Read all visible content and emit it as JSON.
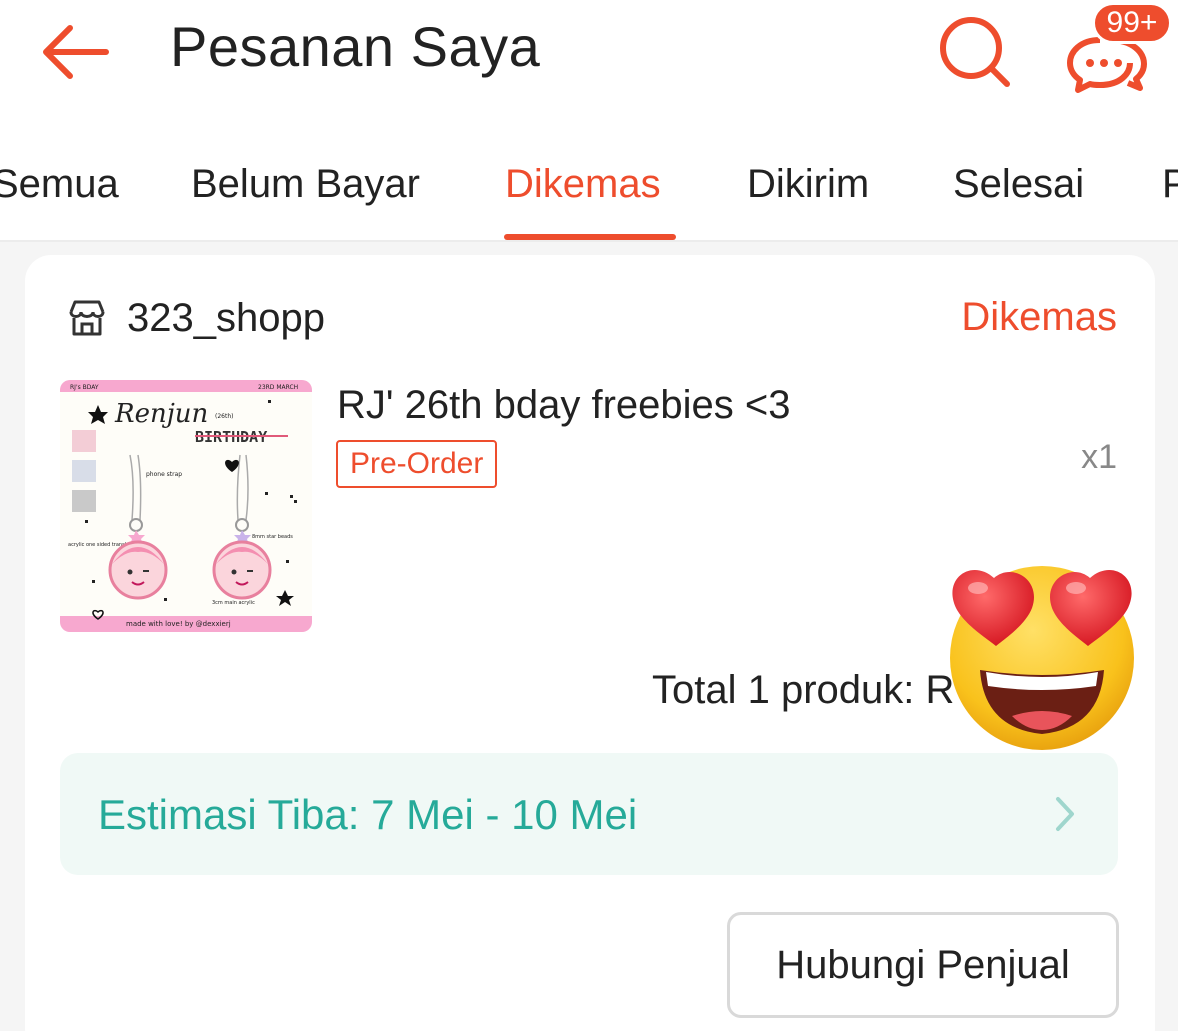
{
  "header": {
    "title": "Pesanan Saya",
    "back_icon": "arrow-left-icon",
    "search_icon": "search-icon",
    "chat_icon": "chat-bubbles-icon",
    "chat_badge": "99+"
  },
  "tabs": [
    {
      "label": "Semua",
      "active": false
    },
    {
      "label": "Belum Bayar",
      "active": false
    },
    {
      "label": "Dikemas",
      "active": true
    },
    {
      "label": "Dikirim",
      "active": false
    },
    {
      "label": "Selesai",
      "active": false
    },
    {
      "label": "P",
      "active": false
    }
  ],
  "order": {
    "shop_name": "323_shopp",
    "shop_icon": "store-icon",
    "status": "Dikemas",
    "product": {
      "name": "RJ' 26th bday freebies <3",
      "tag": "Pre-Order",
      "quantity": "x1",
      "image": {
        "header_left": "RJ's BDAY",
        "header_right": "23RD MARCH",
        "name_script": "Renjun",
        "name_sup": "(26th)",
        "birthday": "BIRTHDAY",
        "label_phone_strap": "phone strap",
        "label_star_beads": "8mm star beads",
        "label_acrylic": "acrylic one sided translucent",
        "label_main_acrylic": "3cm main acrylic",
        "footer": "made with love! by @dexxierj"
      }
    },
    "total_label": "Total 1 produk: R",
    "estimate": "Estimasi Tiba: 7 Mei - 10 Mei",
    "contact_button": "Hubungi Penjual"
  },
  "colors": {
    "accent": "#ee4d2d",
    "teal": "#26aa99",
    "estimate_bg": "#f0f9f6"
  },
  "overlay": {
    "emoji": "heart-eyes-emoji"
  }
}
